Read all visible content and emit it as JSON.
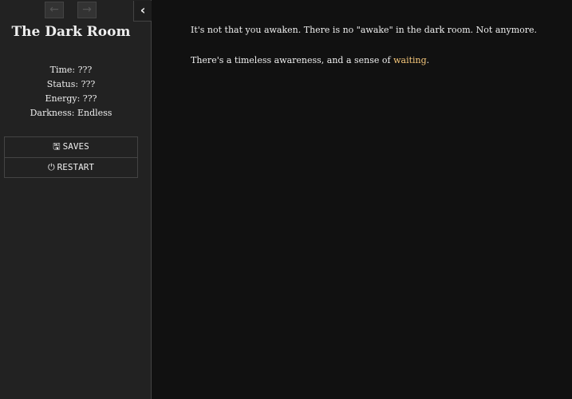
{
  "sidebar": {
    "back_icon": "arrow-left-icon",
    "forward_icon": "arrow-right-icon",
    "toggle_icon": "chevron-left-icon",
    "title": "The Dark Room",
    "stats": {
      "time": "Time: ???",
      "status": "Status: ???",
      "energy": "Energy: ???",
      "darkness": "Darkness: Endless"
    },
    "menu": {
      "saves_label": "SAVES",
      "restart_label": "RESTART"
    }
  },
  "passage": {
    "line1": "It's not that you awaken. There is no \"awake\" in the dark room. Not anymore.",
    "line2_before": "There's a timeless awareness, and a sense of ",
    "line2_link": "waiting",
    "line2_after": "."
  },
  "colors": {
    "background": "#111111",
    "sidebar": "#222222",
    "link": "#f6c77a"
  }
}
